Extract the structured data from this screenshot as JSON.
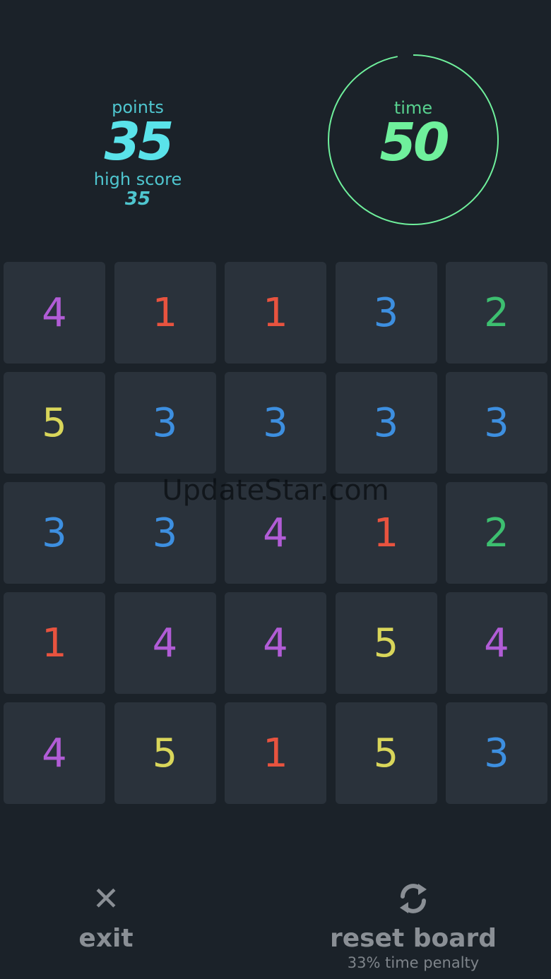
{
  "score": {
    "points_label": "points",
    "points": "35",
    "high_score_label": "high score",
    "high_score": "35"
  },
  "timer": {
    "label": "time",
    "value": "50",
    "progress": 0.97,
    "color": "#6ff09c"
  },
  "board": {
    "colors": {
      "1": "#e8533f",
      "2": "#3dbf70",
      "3": "#3d8fe0",
      "4": "#b15cd6",
      "5": "#d9d65a"
    },
    "rows": [
      [
        "4",
        "1",
        "1",
        "3",
        "2"
      ],
      [
        "5",
        "3",
        "3",
        "3",
        "3"
      ],
      [
        "3",
        "3",
        "4",
        "1",
        "2"
      ],
      [
        "1",
        "4",
        "4",
        "5",
        "4"
      ],
      [
        "4",
        "5",
        "1",
        "5",
        "3"
      ]
    ]
  },
  "watermark": "UpdateStar.com",
  "controls": {
    "exit_icon": "close-icon",
    "exit_label": "exit",
    "reset_icon": "refresh-icon",
    "reset_label": "reset board",
    "reset_sublabel": "33% time penalty"
  }
}
